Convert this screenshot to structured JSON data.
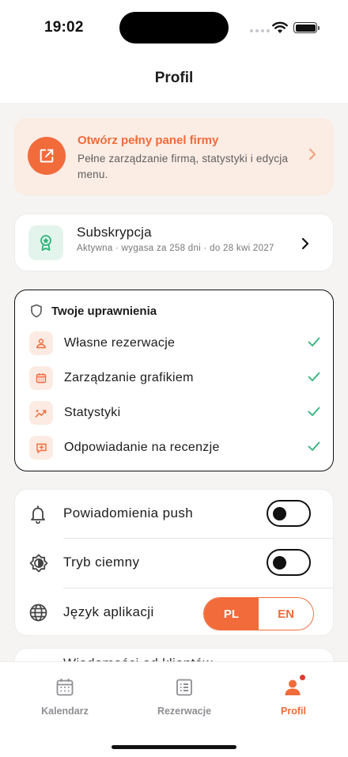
{
  "status": {
    "time": "19:02"
  },
  "nav": {
    "title": "Profil"
  },
  "promo": {
    "title": "Otwórz pełny panel firmy",
    "description": "Pełne zarządzanie firmą, statystyki i edycja menu."
  },
  "subscription": {
    "title": "Subskrypcja",
    "detail": "Aktywna · wygasa za 258 dni · do 28 kwi 2027"
  },
  "permissions": {
    "title": "Twoje uprawnienia",
    "items": [
      {
        "label": "Własne rezerwacje",
        "icon": "person-icon"
      },
      {
        "label": "Zarządzanie grafikiem",
        "icon": "calendar-icon"
      },
      {
        "label": "Statystyki",
        "icon": "chart-icon"
      },
      {
        "label": "Odpowiadanie na recenzje",
        "icon": "review-icon"
      }
    ]
  },
  "settings": {
    "push": {
      "label": "Powiadomienia push",
      "enabled": false
    },
    "dark": {
      "label": "Tryb ciemny",
      "enabled": false
    },
    "language": {
      "label": "Język aplikacji",
      "options": [
        "PL",
        "EN"
      ],
      "selected": "PL"
    }
  },
  "peek": {
    "label": "Wiadomości od klientów"
  },
  "tabs": [
    {
      "label": "Kalendarz",
      "icon": "calendar-icon",
      "active": false
    },
    {
      "label": "Rezerwacje",
      "icon": "list-icon",
      "active": false
    },
    {
      "label": "Profil",
      "icon": "profile-icon",
      "active": true,
      "badge": true
    }
  ],
  "colors": {
    "accent": "#f26b3a",
    "success": "#2fb37a",
    "badge": "#e0392d"
  }
}
